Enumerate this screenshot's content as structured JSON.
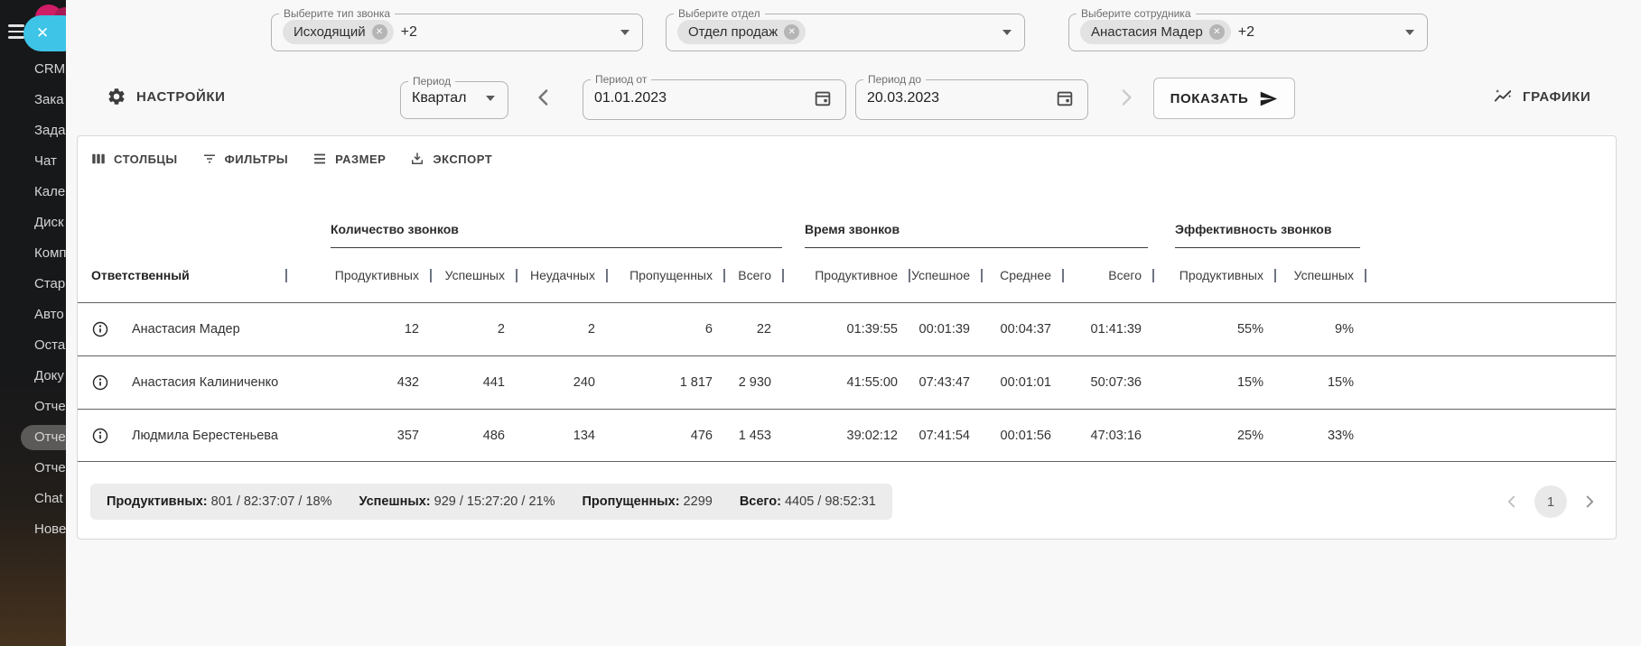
{
  "sidebar": {
    "close_glyph": "✕",
    "items": [
      {
        "label": "CRM"
      },
      {
        "label": "Зака"
      },
      {
        "label": "Зада"
      },
      {
        "label": "Чат"
      },
      {
        "label": "Кале"
      },
      {
        "label": "Диск"
      },
      {
        "label": "Комп"
      },
      {
        "label": "Стар"
      },
      {
        "label": "Авто"
      },
      {
        "label": "Оста"
      },
      {
        "label": "Доку"
      },
      {
        "label": "Отче"
      },
      {
        "label": "Отче"
      },
      {
        "label": "Отче"
      },
      {
        "label": "Chat"
      },
      {
        "label": "Нове"
      }
    ],
    "active_index": 12
  },
  "filters": [
    {
      "label": "Выберите тип звонка",
      "chip": "Исходящий",
      "extra": "+2"
    },
    {
      "label": "Выберите отдел",
      "chip": "Отдел продаж",
      "extra": ""
    },
    {
      "label": "Выберите сотрудника",
      "chip": "Анастасия Мадер",
      "extra": "+2"
    }
  ],
  "controls": {
    "settings_label": "НАСТРОЙКИ",
    "period_label": "Период",
    "period_value": "Квартал",
    "period_from_label": "Период от",
    "period_from_value": "01.01.2023",
    "period_to_label": "Период до",
    "period_to_value": "20.03.2023",
    "show_label": "ПОКАЗАТЬ",
    "charts_label": "ГРАФИКИ"
  },
  "toolbar": {
    "columns": "СТОЛБЦЫ",
    "filters": "ФИЛЬТРЫ",
    "size": "РАЗМЕР",
    "export": "ЭКСПОРТ"
  },
  "table": {
    "groups": [
      {
        "title": "Количество звонков"
      },
      {
        "title": "Время звонков"
      },
      {
        "title": "Эффективность звонков"
      }
    ],
    "responsible_header": "Ответственный",
    "columns": [
      "Продуктивных",
      "Успешных",
      "Неудачных",
      "Пропущенных",
      "Всего",
      "Продуктивное",
      "Успешное",
      "Среднее",
      "Всего",
      "Продуктивных",
      "Успешных"
    ],
    "rows": [
      {
        "name": "Анастасия Мадер",
        "values": [
          "12",
          "2",
          "2",
          "6",
          "22",
          "01:39:55",
          "00:01:39",
          "00:04:37",
          "01:41:39",
          "55%",
          "9%"
        ]
      },
      {
        "name": "Анастасия Калиниченко",
        "values": [
          "432",
          "441",
          "240",
          "1 817",
          "2 930",
          "41:55:00",
          "07:43:47",
          "00:01:01",
          "50:07:36",
          "15%",
          "15%"
        ]
      },
      {
        "name": "Людмила Берестеньева",
        "values": [
          "357",
          "486",
          "134",
          "476",
          "1 453",
          "39:02:12",
          "07:41:54",
          "00:01:56",
          "47:03:16",
          "25%",
          "33%"
        ]
      }
    ]
  },
  "summary": [
    {
      "label": "Продуктивных:",
      "value": "801 / 82:37:07 / 18%"
    },
    {
      "label": "Успешных:",
      "value": "929 / 15:27:20 / 21%"
    },
    {
      "label": "Пропущенных:",
      "value": "2299"
    },
    {
      "label": "Всего:",
      "value": "4405 / 98:52:31"
    }
  ],
  "pagination": {
    "page": "1"
  },
  "colors": {
    "accent_cyan": "#3dc4e6",
    "accent_magenta": "#cf1d66",
    "chip_bg": "#e2e2e2",
    "row_border": "#616161"
  }
}
